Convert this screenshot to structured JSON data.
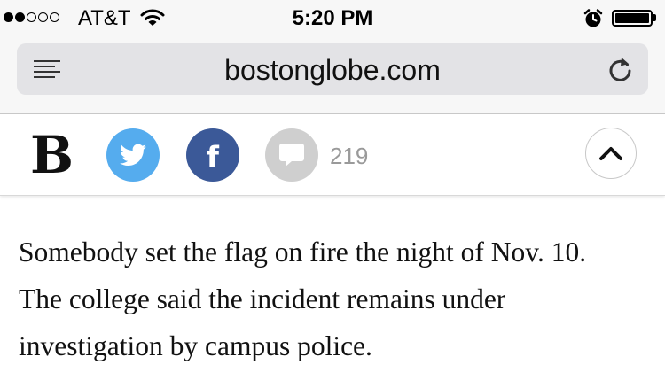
{
  "status_bar": {
    "carrier": "AT&T",
    "time": "5:20 PM",
    "signal_strength": 2,
    "signal_max": 5,
    "icons": [
      "wifi-icon",
      "alarm-icon",
      "battery-icon"
    ],
    "battery_level": 1.0
  },
  "browser": {
    "url": "bostonglobe.com",
    "icons": [
      "reader-icon",
      "reload-icon"
    ]
  },
  "share_bar": {
    "logo": "B",
    "buttons": [
      "twitter-icon",
      "facebook-icon",
      "comment-icon"
    ],
    "comment_count": "219",
    "scroll_top_icon": "chevron-up-icon",
    "colors": {
      "twitter": "#55acee",
      "facebook": "#3b5998",
      "comments": "#cfcfcf"
    }
  },
  "article": {
    "lines": [
      "Somebody set the flag on fire the night of Nov. 10.",
      "The college said the incident remains under",
      "investigation by campus police."
    ]
  }
}
